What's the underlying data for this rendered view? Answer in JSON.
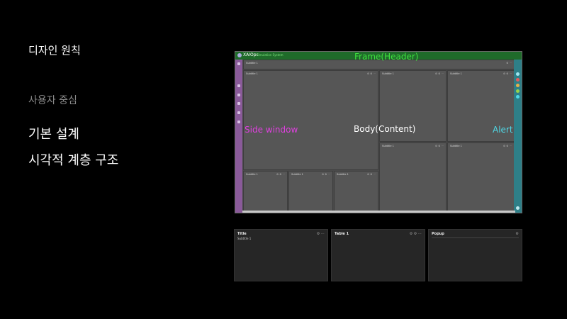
{
  "page": {
    "title": "디자인 원칙",
    "menu": [
      "사용자 중심",
      "기본 설계",
      "시각적 계층 구조"
    ]
  },
  "mockup": {
    "brand": "XAIOps",
    "subtitle": "Simulation System",
    "labels": {
      "frame": "Frame(Header)",
      "side": "Side window",
      "body": "Body(Content)",
      "alert": "Alert"
    },
    "panel_title": "Subtitle 1",
    "top_title": "Subtitle 1"
  },
  "cards": [
    {
      "title": "Title",
      "subtitle": "Subtitle 1",
      "icons": "⚙ ⋯"
    },
    {
      "title": "Table 1",
      "subtitle": "",
      "icons": "⚙ ⚙ ⋯"
    },
    {
      "title": "Popup",
      "subtitle": "",
      "icons": "⚙"
    }
  ],
  "colors": {
    "header": "#1f6b2a",
    "side": "#8a5a9a",
    "alert": "#2e7f88",
    "frame_label": "#3ee03e",
    "side_label": "#e040e0",
    "alert_label": "#4fd8e6"
  }
}
